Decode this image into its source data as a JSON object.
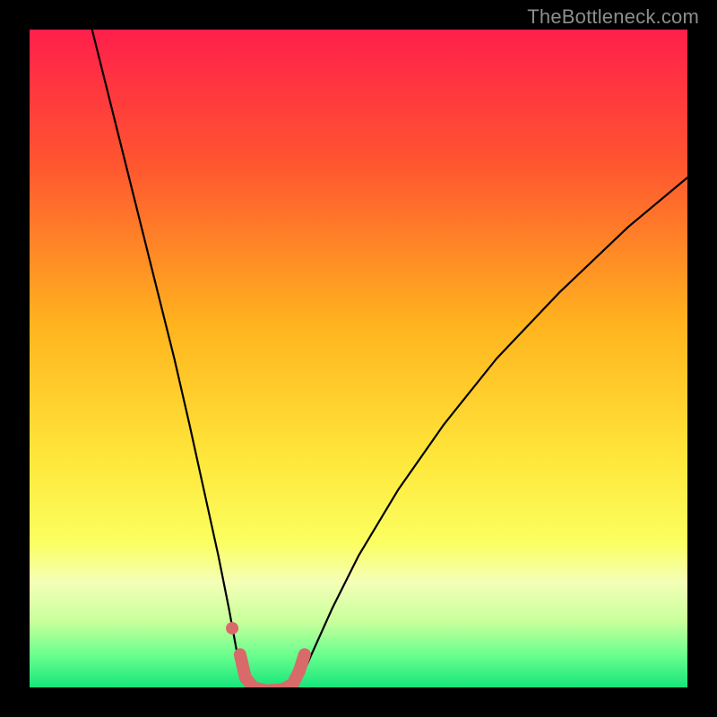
{
  "watermark": "TheBottleneck.com",
  "chart_data": {
    "type": "line",
    "title": "",
    "xlabel": "",
    "ylabel": "",
    "xlim": [
      0,
      100
    ],
    "ylim": [
      0,
      100
    ],
    "background_gradient": {
      "stops": [
        {
          "offset": 0,
          "color": "#ff1f4b"
        },
        {
          "offset": 20,
          "color": "#ff5430"
        },
        {
          "offset": 45,
          "color": "#ffb41e"
        },
        {
          "offset": 65,
          "color": "#ffe63a"
        },
        {
          "offset": 78,
          "color": "#fbff60"
        },
        {
          "offset": 84,
          "color": "#f4ffb7"
        },
        {
          "offset": 90,
          "color": "#c8ff9b"
        },
        {
          "offset": 95,
          "color": "#6bff8e"
        },
        {
          "offset": 100,
          "color": "#16e57b"
        }
      ]
    },
    "series": [
      {
        "name": "left-branch",
        "stroke": "#000000",
        "stroke_width": 2.2,
        "points": [
          {
            "x": 9.5,
            "y": 100.0
          },
          {
            "x": 12.0,
            "y": 90.0
          },
          {
            "x": 14.5,
            "y": 80.0
          },
          {
            "x": 17.0,
            "y": 70.0
          },
          {
            "x": 19.5,
            "y": 60.0
          },
          {
            "x": 22.0,
            "y": 50.0
          },
          {
            "x": 24.3,
            "y": 40.0
          },
          {
            "x": 26.5,
            "y": 30.0
          },
          {
            "x": 28.7,
            "y": 20.0
          },
          {
            "x": 30.3,
            "y": 12.0
          },
          {
            "x": 31.4,
            "y": 6.0
          },
          {
            "x": 32.3,
            "y": 2.0
          },
          {
            "x": 33.2,
            "y": 0.0
          }
        ]
      },
      {
        "name": "right-branch",
        "stroke": "#000000",
        "stroke_width": 2.2,
        "points": [
          {
            "x": 40.3,
            "y": 0.0
          },
          {
            "x": 41.5,
            "y": 2.0
          },
          {
            "x": 43.3,
            "y": 6.0
          },
          {
            "x": 46.0,
            "y": 12.0
          },
          {
            "x": 50.0,
            "y": 20.0
          },
          {
            "x": 56.0,
            "y": 30.0
          },
          {
            "x": 63.0,
            "y": 40.0
          },
          {
            "x": 71.0,
            "y": 50.0
          },
          {
            "x": 80.5,
            "y": 60.0
          },
          {
            "x": 91.0,
            "y": 70.0
          },
          {
            "x": 100.0,
            "y": 77.5
          }
        ]
      },
      {
        "name": "valley-marker",
        "stroke": "#d86a6a",
        "stroke_width": 14,
        "points": [
          {
            "x": 32.0,
            "y": 5.0
          },
          {
            "x": 32.8,
            "y": 1.5
          },
          {
            "x": 34.0,
            "y": 0.0
          },
          {
            "x": 36.0,
            "y": -0.5
          },
          {
            "x": 38.5,
            "y": -0.3
          },
          {
            "x": 40.0,
            "y": 0.5
          },
          {
            "x": 41.0,
            "y": 2.5
          },
          {
            "x": 41.8,
            "y": 5.0
          }
        ]
      }
    ],
    "markers": [
      {
        "name": "valley-start-dot",
        "x": 30.8,
        "y": 9.0,
        "r": 7,
        "fill": "#d86a6a"
      }
    ]
  }
}
